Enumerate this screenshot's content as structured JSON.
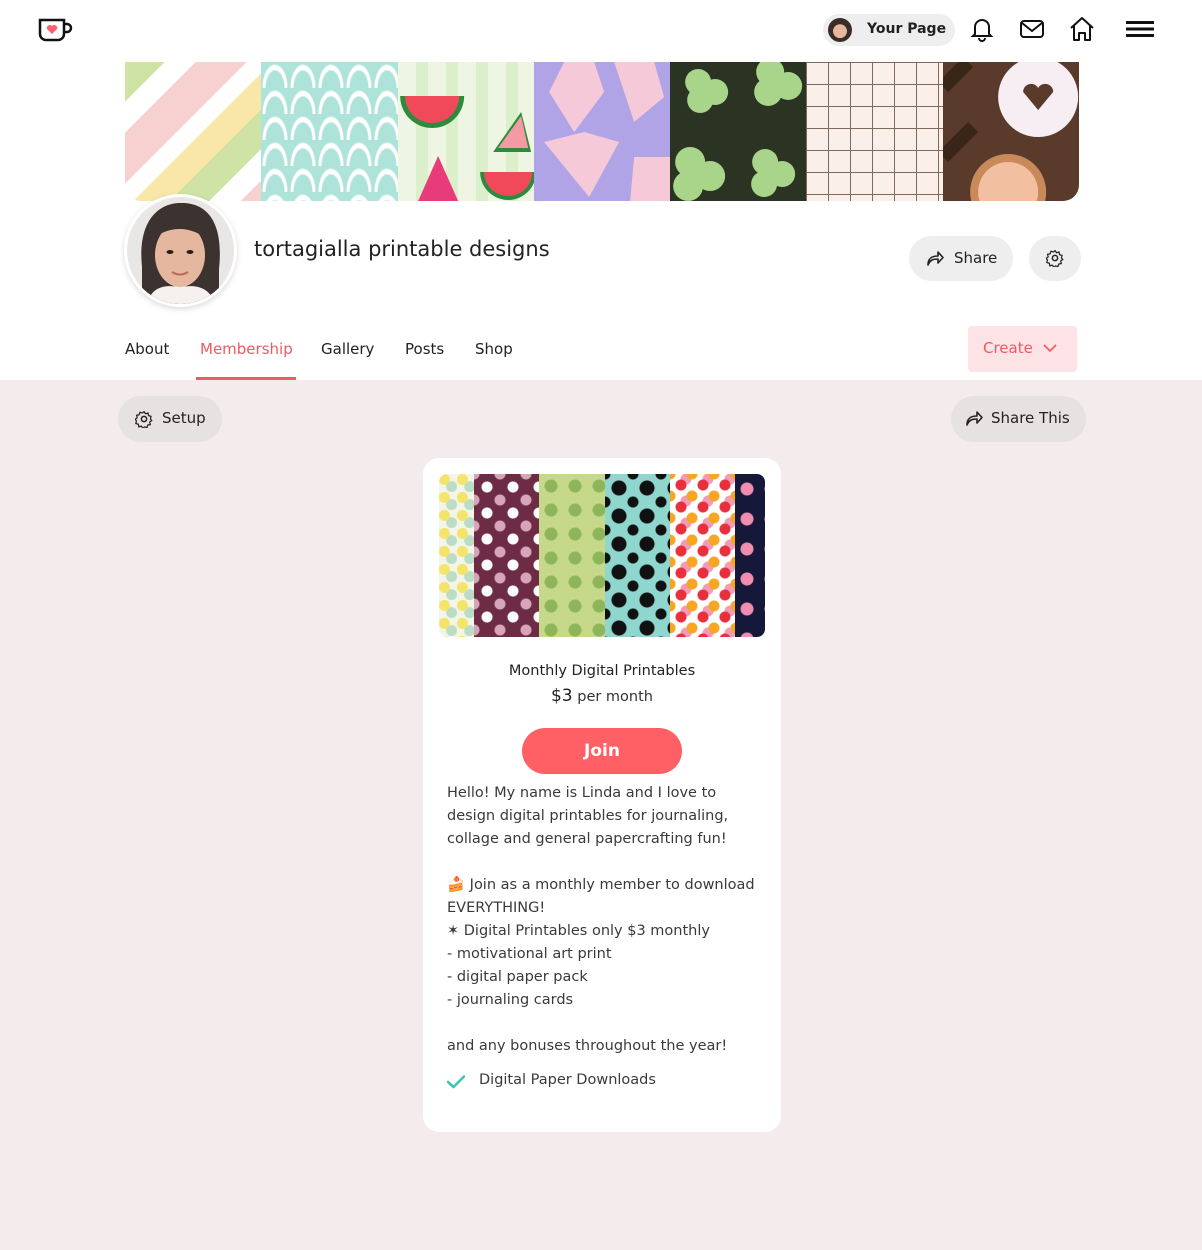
{
  "topbar": {
    "logo_icon": "kofi-cup-logo",
    "your_page_label": "Your Page",
    "icons": [
      "bell-icon",
      "mail-icon",
      "home-icon",
      "menu-icon"
    ]
  },
  "profile": {
    "page_title": "tortagialla printable designs",
    "share_label": "Share"
  },
  "tabs": [
    {
      "label": "About"
    },
    {
      "label": "Membership"
    },
    {
      "label": "Gallery"
    },
    {
      "label": "Posts"
    },
    {
      "label": "Shop"
    }
  ],
  "active_tab": "Membership",
  "create_label": "Create",
  "toolbar": {
    "setup_label": "Setup",
    "share_this_label": "Share This"
  },
  "tier": {
    "name": "Monthly Digital Printables",
    "price_amount": "$3",
    "price_period": "per month",
    "join_label": "Join",
    "description": [
      "Hello! My name is Linda and I love to",
      "design digital printables for journaling,",
      "collage and general papercrafting fun!",
      "",
      "🍰 Join as a monthly member to download",
      "EVERYTHING!",
      "✶ Digital Printables only $3 monthly",
      "- motivational art print",
      "- digital paper pack",
      "- journaling cards",
      "",
      "and any bonuses throughout the year!"
    ],
    "benefit": "Digital Paper Downloads"
  },
  "colors": {
    "accent": "#ee5a63",
    "join": "#fe6065",
    "background": "#f3ebec",
    "check": "#3cc8a8"
  }
}
